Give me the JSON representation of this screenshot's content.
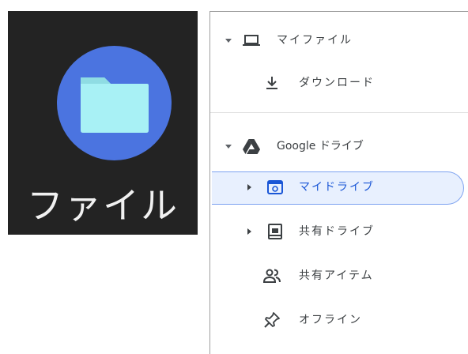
{
  "app_tile": {
    "icon": "files-folder-icon",
    "label": "ファイル",
    "colors": {
      "background": "#232323",
      "circle": "#4b74e0",
      "folder": "#a8f1f5"
    }
  },
  "nav": {
    "my_files": {
      "label": "マイファイル",
      "icon": "laptop-icon",
      "expanded": true
    },
    "downloads": {
      "label": "ダウンロード",
      "icon": "download-icon"
    },
    "google_drive": {
      "label": "Google ドライブ",
      "icon": "google-drive-icon",
      "expanded": true
    },
    "my_drive": {
      "label": "マイドライブ",
      "icon": "my-drive-icon",
      "selected": true,
      "collapsed": true
    },
    "shared_drives": {
      "label": "共有ドライブ",
      "icon": "shared-drive-icon",
      "collapsed": true
    },
    "shared_items": {
      "label": "共有アイテム",
      "icon": "people-icon"
    },
    "offline": {
      "label": "オフライン",
      "icon": "pin-icon"
    }
  },
  "colors": {
    "selected_bg": "#e8f0fe",
    "selected_text": "#1a56d6",
    "text": "#3c4043"
  }
}
